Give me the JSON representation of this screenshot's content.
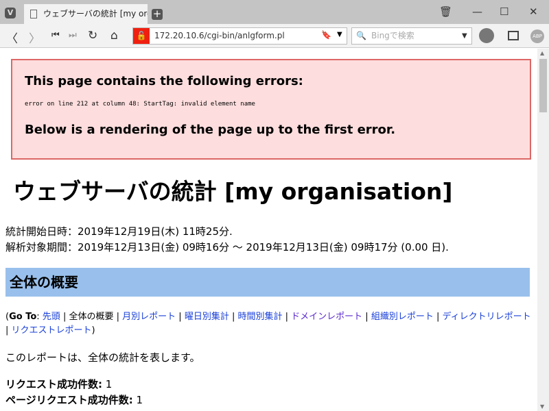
{
  "browser": {
    "tab_title": "ウェブサーバの統計 [my organisation]",
    "url": "172.20.10.6/cgi-bin/anlgform.pl",
    "search_placeholder": "Bingで検索",
    "logo": "V",
    "adblock": "ABP"
  },
  "error": {
    "title": "This page contains the following errors:",
    "message": "error on line 212 at column 48: StartTag: invalid element name",
    "subtitle": "Below is a rendering of the page up to the first error."
  },
  "page": {
    "title": "ウェブサーバの統計 [my organisation]",
    "start": "統計開始日時：2019年12月19日(木) 11時25分.",
    "period": "解析対象期間：2019年12月13日(金) 09時16分 〜 2019年12月13日(金) 09時17分 (0.00 日).",
    "section": "全体の概要",
    "goto_label": "Go To",
    "goto_current": "全体の概要",
    "goto_links": [
      "先頭",
      "月別レポート",
      "曜日別集計",
      "時間別集計",
      "ドメインレポート",
      "組織別レポート",
      "ディレクトリレポート",
      "リクエストレポート"
    ],
    "description": "このレポートは、全体の統計を表します。",
    "stats": [
      {
        "label": "リクエスト成功件数:",
        "value": "1"
      },
      {
        "label": "ページリクエスト成功件数:",
        "value": "1"
      }
    ]
  }
}
